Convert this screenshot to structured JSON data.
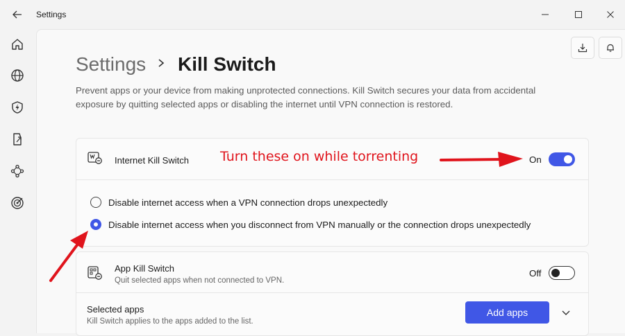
{
  "window": {
    "title": "Settings"
  },
  "sidebar": {
    "items": [
      {
        "icon": "home-icon"
      },
      {
        "icon": "globe-icon"
      },
      {
        "icon": "shield-bolt-icon"
      },
      {
        "icon": "split-tunnel-icon"
      },
      {
        "icon": "network-icon"
      },
      {
        "icon": "target-icon"
      }
    ]
  },
  "breadcrumb": {
    "parent": "Settings",
    "current": "Kill Switch"
  },
  "description": "Prevent apps or your device from making unprotected connections. Kill Switch secures your data from accidental exposure by quitting selected apps or disabling the internet until VPN connection is restored.",
  "internet_kill_switch": {
    "title": "Internet Kill Switch",
    "state_label": "On",
    "enabled": true,
    "options": [
      {
        "label": "Disable internet access when a VPN connection drops unexpectedly",
        "selected": false
      },
      {
        "label": "Disable internet access when you disconnect from VPN manually or the connection drops unexpectedly",
        "selected": true
      }
    ]
  },
  "app_kill_switch": {
    "title": "App Kill Switch",
    "subtitle": "Quit selected apps when not connected to VPN.",
    "state_label": "Off",
    "enabled": false
  },
  "selected_apps": {
    "title": "Selected apps",
    "subtitle": "Kill Switch applies to the apps added to the list.",
    "add_button": "Add apps"
  },
  "annotation": {
    "text": "Turn these on while torrenting",
    "color": "#e0141c"
  },
  "colors": {
    "accent": "#4057e6"
  }
}
